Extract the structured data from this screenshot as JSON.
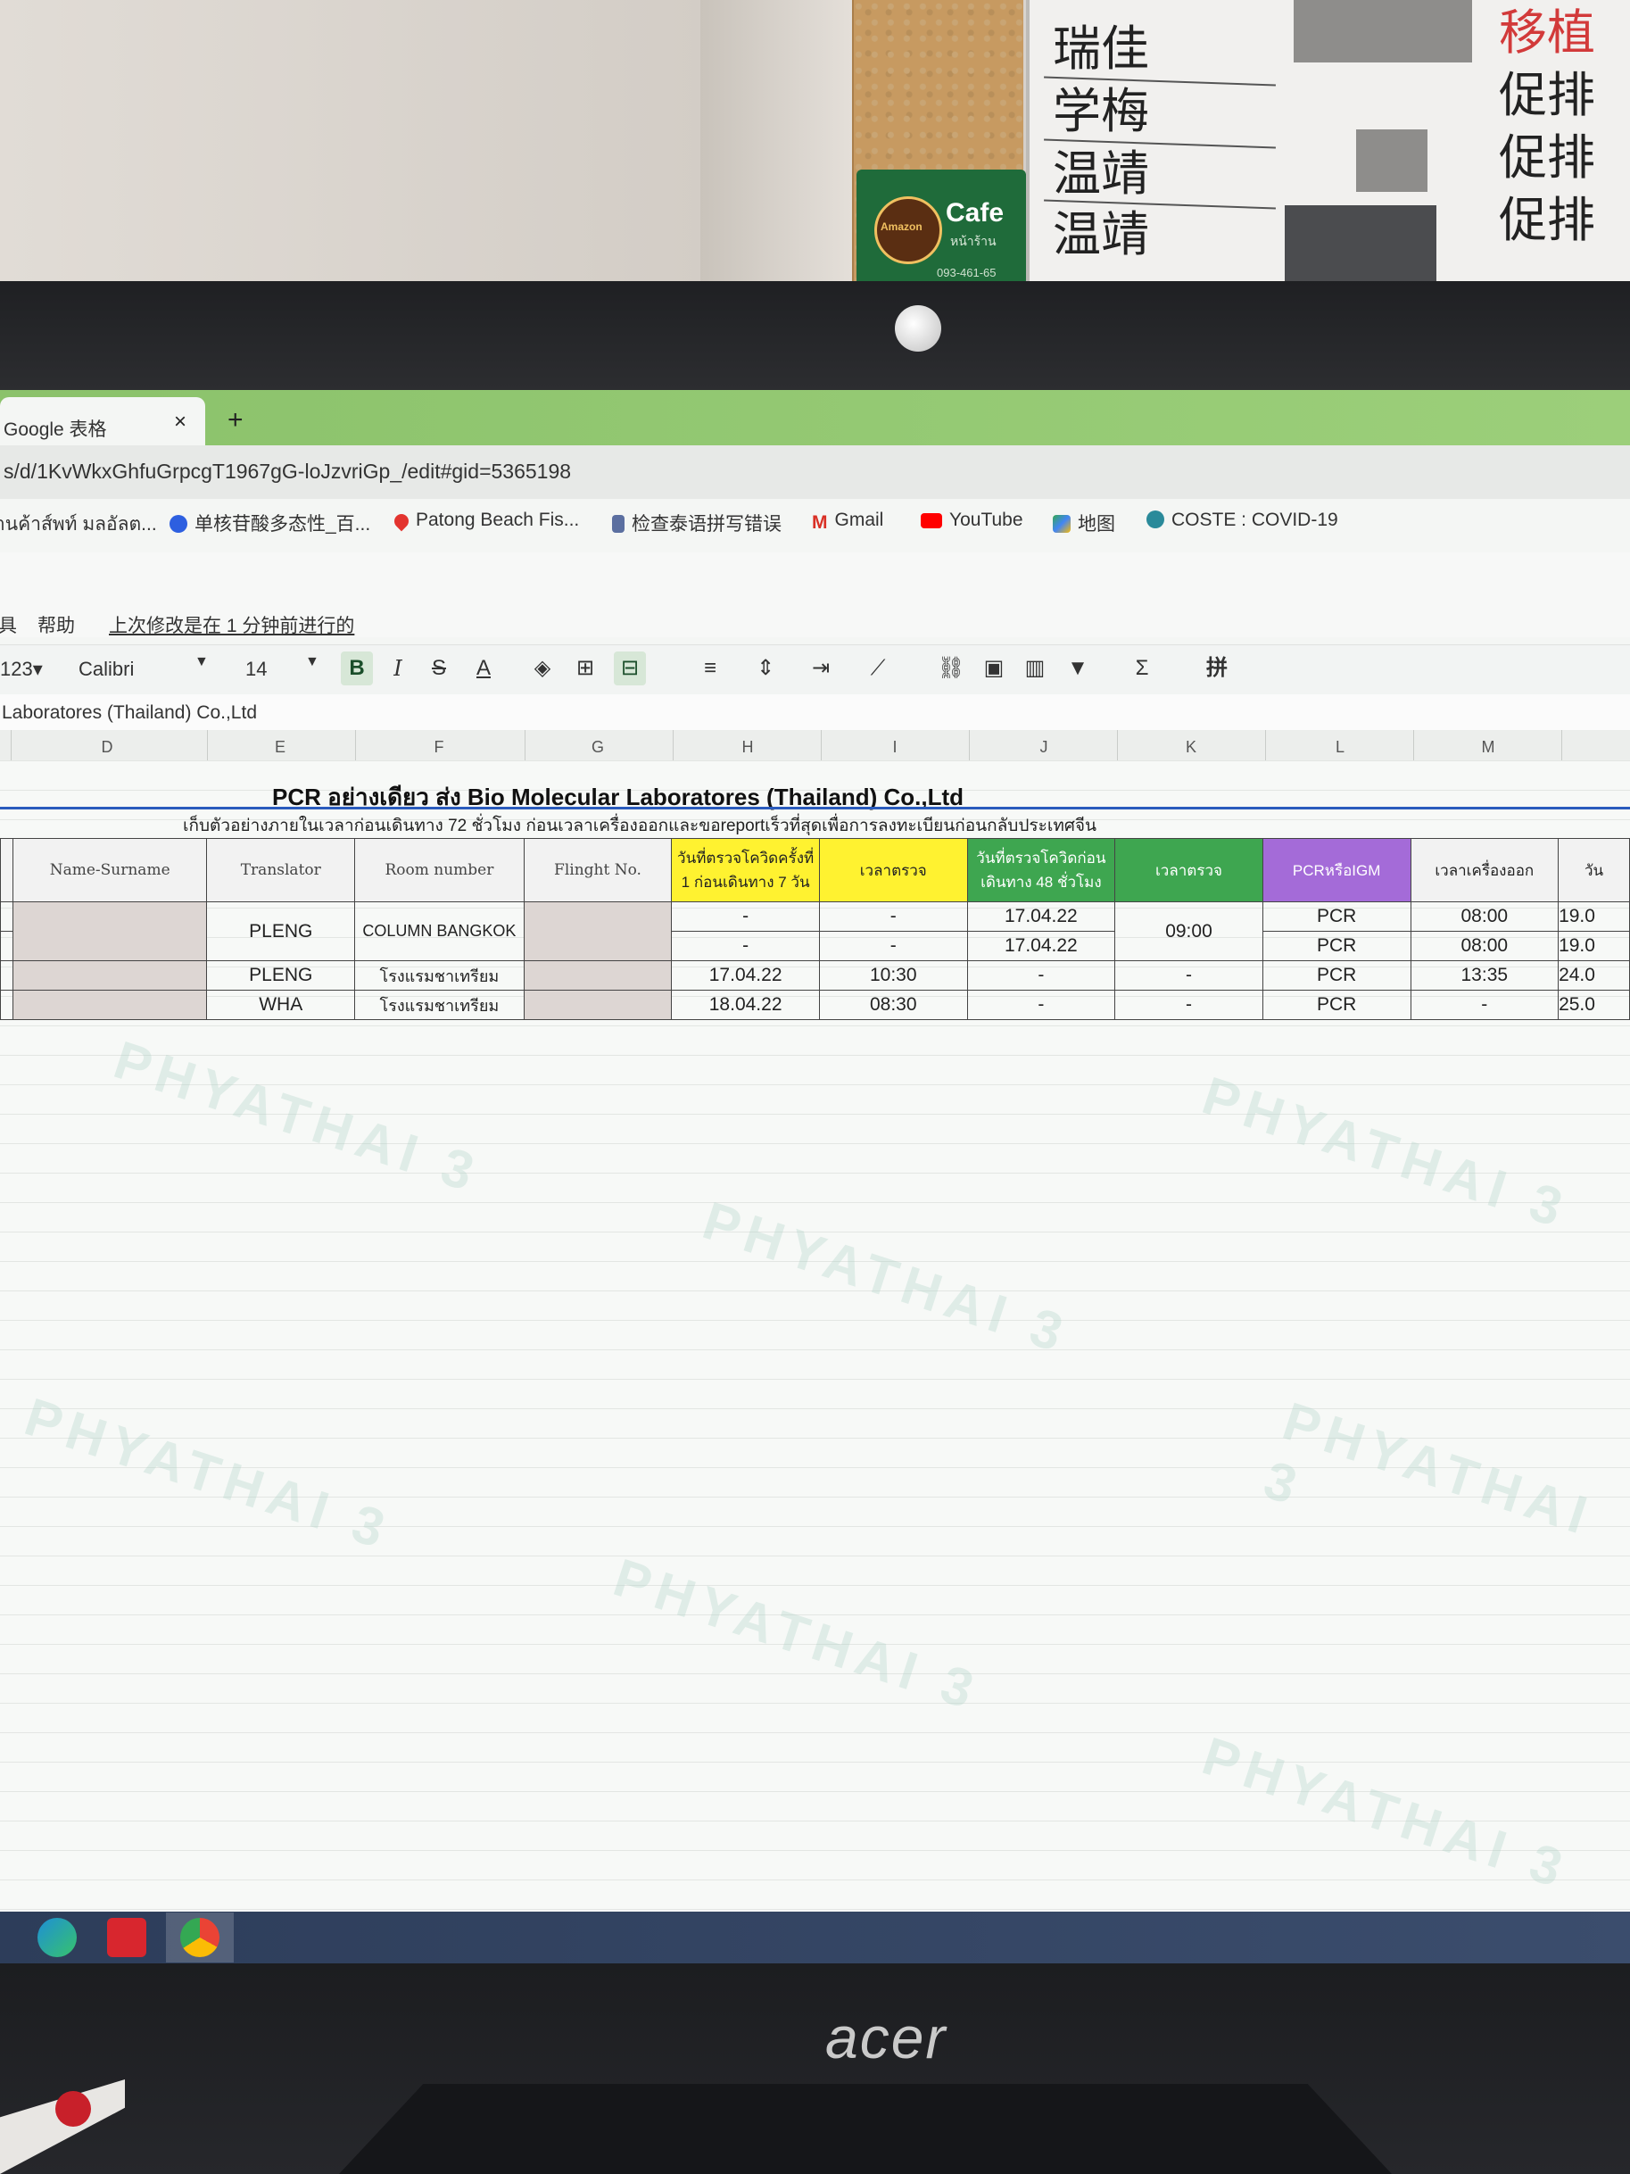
{
  "scene": {
    "cafe_sign": {
      "title": "Cafe",
      "subtitle": "หน้าร้าน"
    },
    "cafe_badge": "Amazon",
    "phone_on_sign": "093-461-65",
    "whiteboard_names": [
      "瑞佳",
      "学梅",
      "温靖",
      "温靖"
    ],
    "whiteboard_status": [
      "移植",
      "促排",
      "促排",
      "促排"
    ],
    "monitor_brand": "acer"
  },
  "browser": {
    "tab_title": "Google 表格",
    "tab_close": "×",
    "new_tab": "+",
    "url": "s/d/1KvWkxGhfuGrpcgT1967gG-loJzvriGp_/edit#gid=5365198",
    "bookmarks": [
      {
        "label": "้านค้าส์พท์ มลอัลต...",
        "icon": "web-icon",
        "color": "#8a8a8a"
      },
      {
        "label": "单核苷酸多态性_百...",
        "icon": "baidu-paw-icon",
        "color": "#2d5fe0"
      },
      {
        "label": "Patong Beach Fis...",
        "icon": "map-pin-icon",
        "color": "#e3342f"
      },
      {
        "label": "检查泰语拼写错误",
        "icon": "bookmark-icon",
        "color": "#5b6fa0"
      },
      {
        "label": "Gmail",
        "icon": "gmail-icon",
        "color": "#d93025"
      },
      {
        "label": "YouTube",
        "icon": "youtube-icon",
        "color": "#ff0000"
      },
      {
        "label": "地图",
        "icon": "maps-icon",
        "color": "#34a853"
      },
      {
        "label": "COSTE : COVID-19",
        "icon": "covid-icon",
        "color": "#2a8a9a"
      }
    ]
  },
  "sheets": {
    "menu": [
      "具",
      "帮助"
    ],
    "last_edit": "上次修改是在 1 分钟前进行的",
    "toolbar": {
      "number_format": "123▾",
      "font": "Calibri",
      "font_size": "14",
      "bold": "B",
      "italic": "I",
      "strike": "S",
      "text_color": "A",
      "input_tools": "拼"
    },
    "formula_value": "Laboratores (Thailand) Co.,Ltd",
    "columns": [
      "D",
      "E",
      "F",
      "G",
      "H",
      "I",
      "J",
      "K",
      "L",
      "M"
    ],
    "title": "PCR อย่างเดียว ส่ง Bio Molecular Laboratores (Thailand) Co.,Ltd",
    "note": "เก็บตัวอย่างภายในเวลาก่อนเดินทาง 72 ชั่วโมง ก่อนเวลาเครื่องออกและขอreportเร็วที่สุดเพื่อการลงทะเบียนก่อนกลับประเทศจีน",
    "headers": {
      "name": "Name-Surname",
      "translator": "Translator",
      "room": "Room number",
      "flight": "Flinght No.",
      "first_test_date": "วันที่ตรวจโควิดครั้งที่ 1 ก่อนเดินทาง 7 วัน",
      "test_time_1": "เวลาตรวจ",
      "test_date_48": "วันที่ตรวจโควิดก่อนเดินทาง 48 ชั่วโมง",
      "test_time_2": "เวลาตรวจ",
      "pcr_igm": "PCRหรือIGM",
      "departure": "เวลาเครื่องออก",
      "date_partial": "วัน"
    },
    "rows": [
      {
        "translator": "PLENG",
        "room": "COLUMN BANGKOK",
        "first_date": "-",
        "time1": "-",
        "date48": "17.04.22",
        "time2": "09:00",
        "type": "PCR",
        "departure": "08:00",
        "date": "19.0"
      },
      {
        "translator": "",
        "room": "",
        "first_date": "-",
        "time1": "-",
        "date48": "17.04.22",
        "time2": "",
        "type": "PCR",
        "departure": "08:00",
        "date": "19.0"
      },
      {
        "translator": "PLENG",
        "room": "โรงแรมชาเทรียม",
        "first_date": "17.04.22",
        "time1": "10:30",
        "date48": "-",
        "time2": "-",
        "type": "PCR",
        "departure": "13:35",
        "date": "24.0"
      },
      {
        "translator": "WHA",
        "room": "โรงแรมชาเทรียม",
        "first_date": "18.04.22",
        "time1": "08:30",
        "date48": "-",
        "time2": "-",
        "type": "PCR",
        "departure": "-",
        "date": "25.0"
      }
    ],
    "watermark": "PHYATHAI 3"
  }
}
